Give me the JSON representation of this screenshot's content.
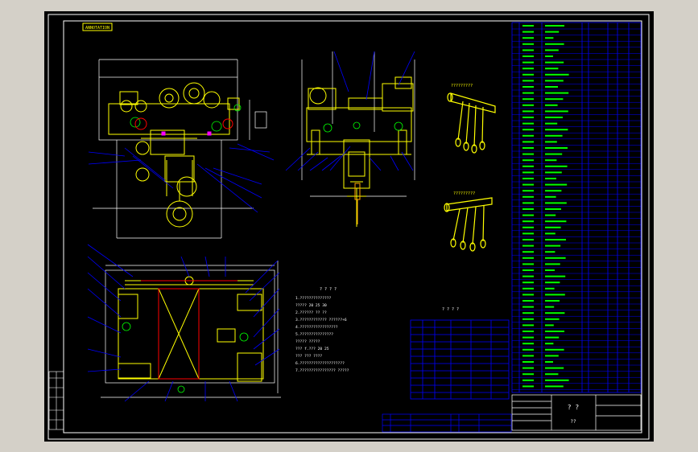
{
  "drawing": {
    "tag_label": "ANNOTATION",
    "tech_title": "? ? ? ?",
    "tech_lines": [
      "1.??????????????",
      "  ?????  20  25  30",
      "2.??????  ??  ??",
      "3.???????????? ??????+6",
      "4.?????????????????",
      "5.???????????????",
      "  ?????  ?????",
      "  ???  f.???   20  25",
      "  ???  ???  ????",
      "6.????????????????????",
      "7.????????????????  ?????"
    ],
    "table_title": "? ? ? ?",
    "sketch_label_1": "?????????",
    "sketch_label_2": "?????????",
    "title_block": {
      "name": "? ?",
      "sub": "??"
    }
  },
  "colors": {
    "background": "#000000",
    "frame": "#ffffff",
    "accent": "#ffff00",
    "line": "#0000ff",
    "text": "#00ff00",
    "part": "#ff00ff"
  }
}
